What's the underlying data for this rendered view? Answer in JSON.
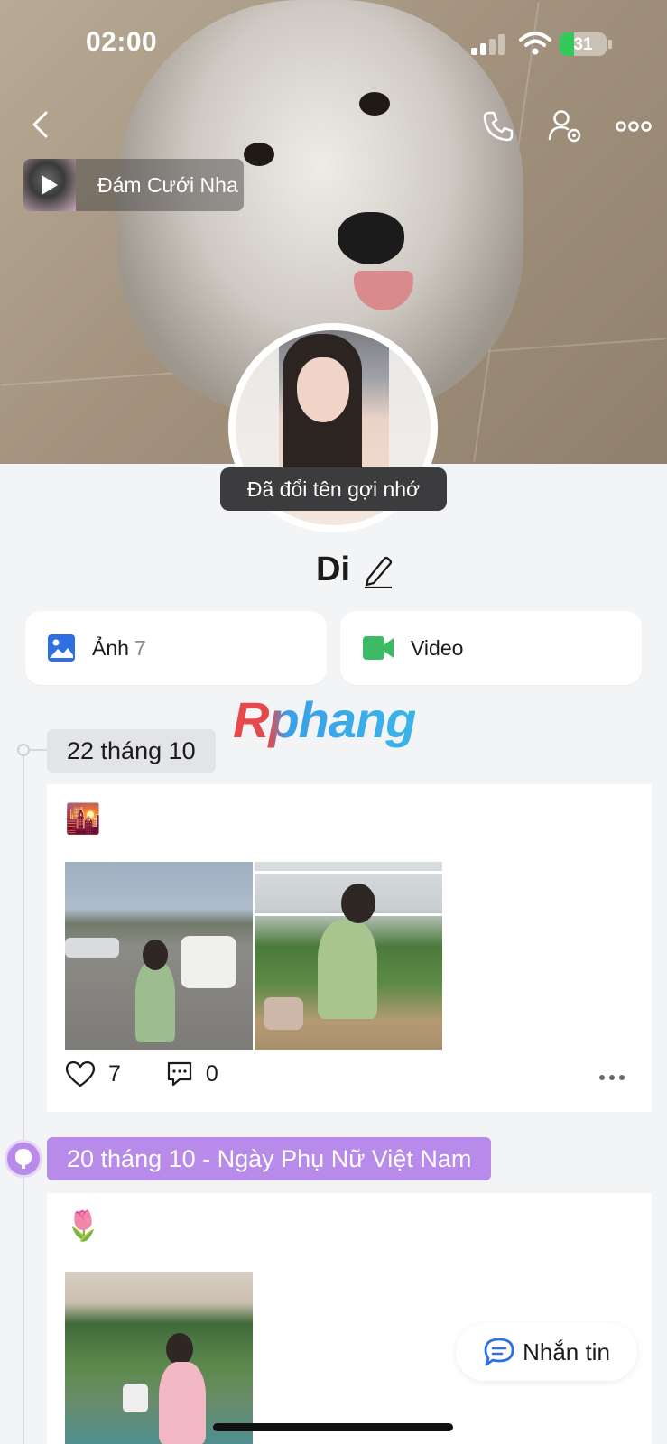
{
  "status_bar": {
    "time": "02:00",
    "battery_level": "31",
    "battery_fraction": 0.31
  },
  "header": {
    "back_icon": "chevron-left-icon",
    "call_icon": "phone-icon",
    "profile_settings_icon": "user-gear-icon",
    "more_icon": "more-horizontal-icon"
  },
  "music": {
    "title": "Đám Cưới Nha",
    "play_icon": "play-icon"
  },
  "toast": {
    "text": "Đã đổi tên gợi nhớ"
  },
  "profile": {
    "name": "Di",
    "edit_icon": "pencil-icon"
  },
  "media": {
    "photos": {
      "label": "Ảnh",
      "count": "7",
      "icon": "image-icon",
      "color": "#2f6fe4"
    },
    "videos": {
      "label": "Video",
      "icon": "video-camera-icon",
      "color": "#3dbb64"
    }
  },
  "watermark": {
    "text": "Rphang"
  },
  "timeline": [
    {
      "date": "22 tháng 10",
      "emoji": "🌇",
      "likes": "7",
      "comments": "0"
    },
    {
      "date": "20 tháng 10 - Ngày Phụ Nữ Việt Nam",
      "emoji": "🌷",
      "accent": "#b88aea"
    }
  ],
  "message_button": {
    "label": "Nhắn tin",
    "icon": "chat-bubble-icon",
    "color": "#2f6fe4"
  }
}
